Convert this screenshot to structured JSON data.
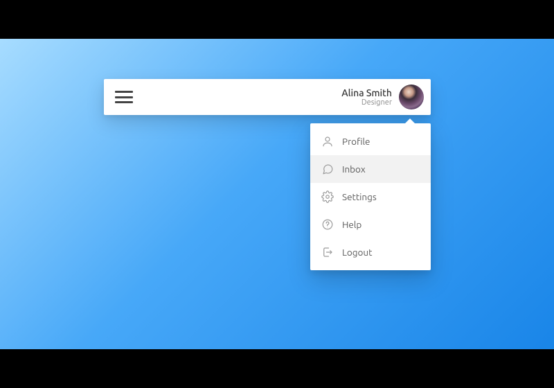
{
  "user": {
    "name": "Alina Smith",
    "role": "Designer"
  },
  "menu": {
    "items": [
      {
        "label": "Profile",
        "icon": "user-icon",
        "hovered": false
      },
      {
        "label": "Inbox",
        "icon": "chat-icon",
        "hovered": true
      },
      {
        "label": "Settings",
        "icon": "gear-icon",
        "hovered": false
      },
      {
        "label": "Help",
        "icon": "help-icon",
        "hovered": false
      },
      {
        "label": "Logout",
        "icon": "logout-icon",
        "hovered": false
      }
    ]
  }
}
